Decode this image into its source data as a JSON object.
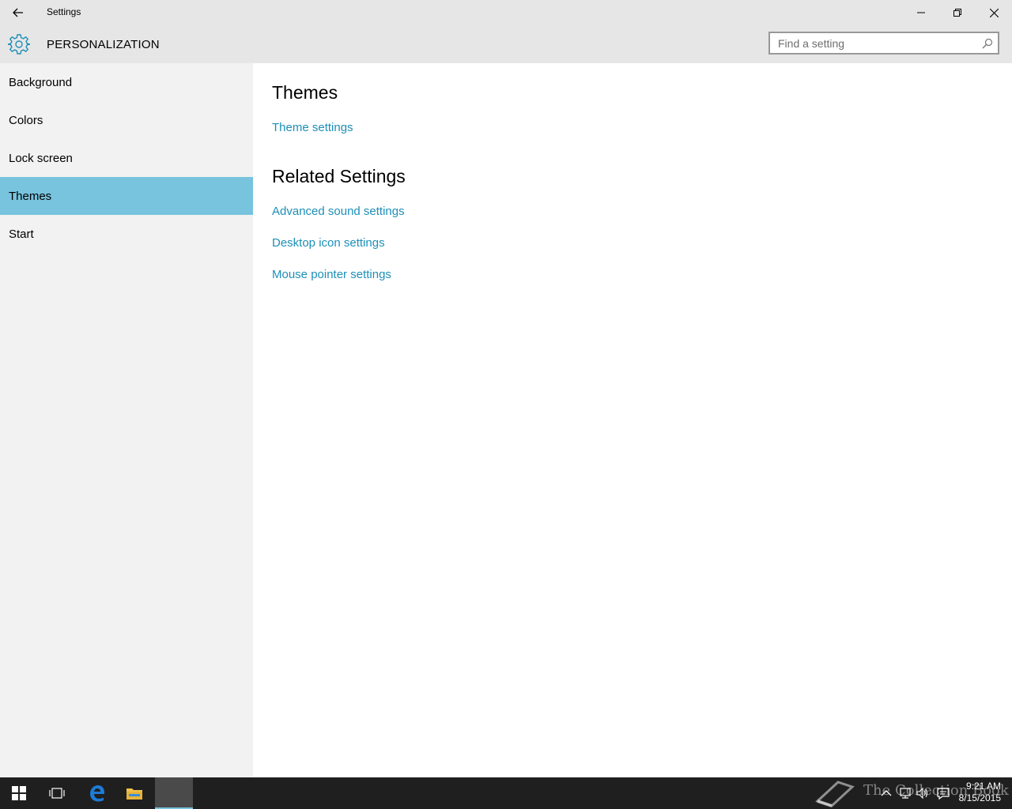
{
  "window": {
    "title": "Settings",
    "controls": [
      "minimize",
      "restore",
      "close"
    ]
  },
  "header": {
    "section_title": "PERSONALIZATION",
    "search_placeholder": "Find a setting"
  },
  "sidebar": {
    "items": [
      {
        "label": "Background",
        "selected": false
      },
      {
        "label": "Colors",
        "selected": false
      },
      {
        "label": "Lock screen",
        "selected": false
      },
      {
        "label": "Themes",
        "selected": true
      },
      {
        "label": "Start",
        "selected": false
      }
    ]
  },
  "main": {
    "themes_heading": "Themes",
    "theme_settings_link": "Theme settings",
    "related_heading": "Related Settings",
    "related_links": [
      "Advanced sound settings",
      "Desktop icon settings",
      "Mouse pointer settings"
    ]
  },
  "taskbar": {
    "apps": [
      "start-icon",
      "task-view-icon",
      "edge-icon",
      "file-explorer-icon",
      "settings-app"
    ],
    "clock_time": "9:21 AM",
    "clock_date": "8/15/2015",
    "watermark": "The Collection Book"
  },
  "colors": {
    "accent": "#78c3de",
    "link": "#1d8fb7",
    "titlebar": "#e6e6e6",
    "sidebar": "#f2f2f2",
    "taskbar": "#1f1f1f"
  }
}
